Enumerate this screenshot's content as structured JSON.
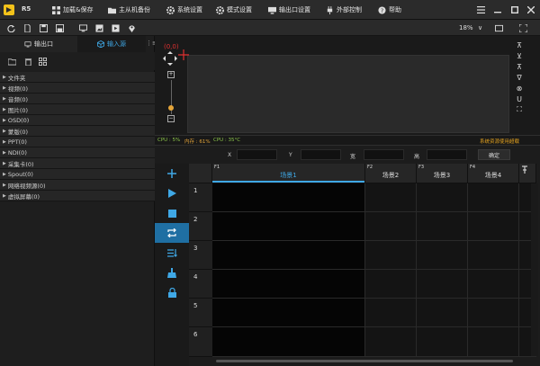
{
  "app": {
    "name": "R5"
  },
  "menu": [
    {
      "label": "加载&保存",
      "icon": "grid-icon"
    },
    {
      "label": "主从机备份",
      "icon": "folder-icon"
    },
    {
      "label": "系统设置",
      "icon": "gear-icon"
    },
    {
      "label": "模式设置",
      "icon": "gear-icon"
    },
    {
      "label": "输出口设置",
      "icon": "monitor-icon"
    },
    {
      "label": "外部控制",
      "icon": "plug-icon"
    },
    {
      "label": "帮助",
      "icon": "help-icon"
    }
  ],
  "toolbar": {
    "zoom": "18%"
  },
  "left_tabs": {
    "output": "输出口",
    "input": "输入源"
  },
  "tree": [
    "文件夹",
    "视频(0)",
    "音频(0)",
    "图片(0)",
    "OSD(0)",
    "蒙版(0)",
    "PPT(0)",
    "NDI(0)",
    "采集卡(0)",
    "Spout(0)",
    "网络视频源(0)",
    "虚拟屏幕(0)"
  ],
  "preview": {
    "coord": "(0,0)"
  },
  "status": {
    "cpu": "CPU : 5%",
    "mem": "内存 : 61%",
    "temp": "CPU : 35°C",
    "alert": "系统资源使用超载"
  },
  "params": {
    "x": "X",
    "y": "Y",
    "w": "宽",
    "h": "高",
    "ok": "确定"
  },
  "scenes": {
    "columns": [
      {
        "f": "F1",
        "name": "场景1"
      },
      {
        "f": "F2",
        "name": "场景2"
      },
      {
        "f": "F3",
        "name": "场景3"
      },
      {
        "f": "F4",
        "name": "场景4"
      }
    ],
    "rows": [
      "1",
      "2",
      "3",
      "4",
      "5",
      "6"
    ]
  },
  "colors": {
    "accent": "#1f6fa3",
    "link": "#3fa8e6",
    "alert": "#e0a020",
    "coord": "#e03030"
  }
}
